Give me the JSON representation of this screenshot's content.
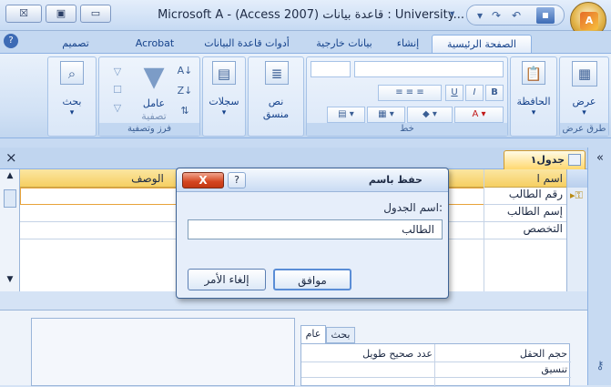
{
  "window": {
    "title": "Microsoft A - (Access 2007) قاعدة بيانات : University...",
    "qat_icons": [
      "save-icon",
      "undo-icon",
      "redo-icon",
      "customize-icon"
    ]
  },
  "tabs": [
    {
      "label": "الصفحة الرئيسية",
      "active": true
    },
    {
      "label": "إنشاء"
    },
    {
      "label": "بيانات خارجية"
    },
    {
      "label": "أدوات قاعدة البيانات"
    },
    {
      "label": "Acrobat"
    },
    {
      "label": "تصميم"
    }
  ],
  "ribbon": {
    "views_button": "عرض",
    "views_group": "طرق عرض",
    "clipboard_button": "الحافظة",
    "font_group": "خط",
    "richtext_button": "نص",
    "richtext_sub": "منسق",
    "records_button": "سجلات",
    "filter_button": "عامل",
    "filter_sub": "تصفية",
    "sortfilter_group": "فرز وتصفية",
    "find_button": "بحث"
  },
  "doc": {
    "tab_label": "جدول١",
    "col_fieldname_header": "اسم ا",
    "col_description_header": "الوصف",
    "rows": [
      "رقم الطالب",
      "إسم الطالب",
      "التخصص"
    ]
  },
  "lower": {
    "tab_general": "عام",
    "tab_lookup": "بحث",
    "props": [
      {
        "name": "حجم الحقل",
        "value": "عدد صحيح طويل"
      },
      {
        "name": "تنسيق",
        "value": ""
      }
    ]
  },
  "dialog": {
    "title": "حفظ باسم",
    "label": "اسم الجدول:",
    "value": "الطالب",
    "ok": "موافق",
    "cancel": "إلغاء الأمر",
    "close": "X",
    "help": "?"
  },
  "close_x": "×",
  "nav_chevron": "«"
}
